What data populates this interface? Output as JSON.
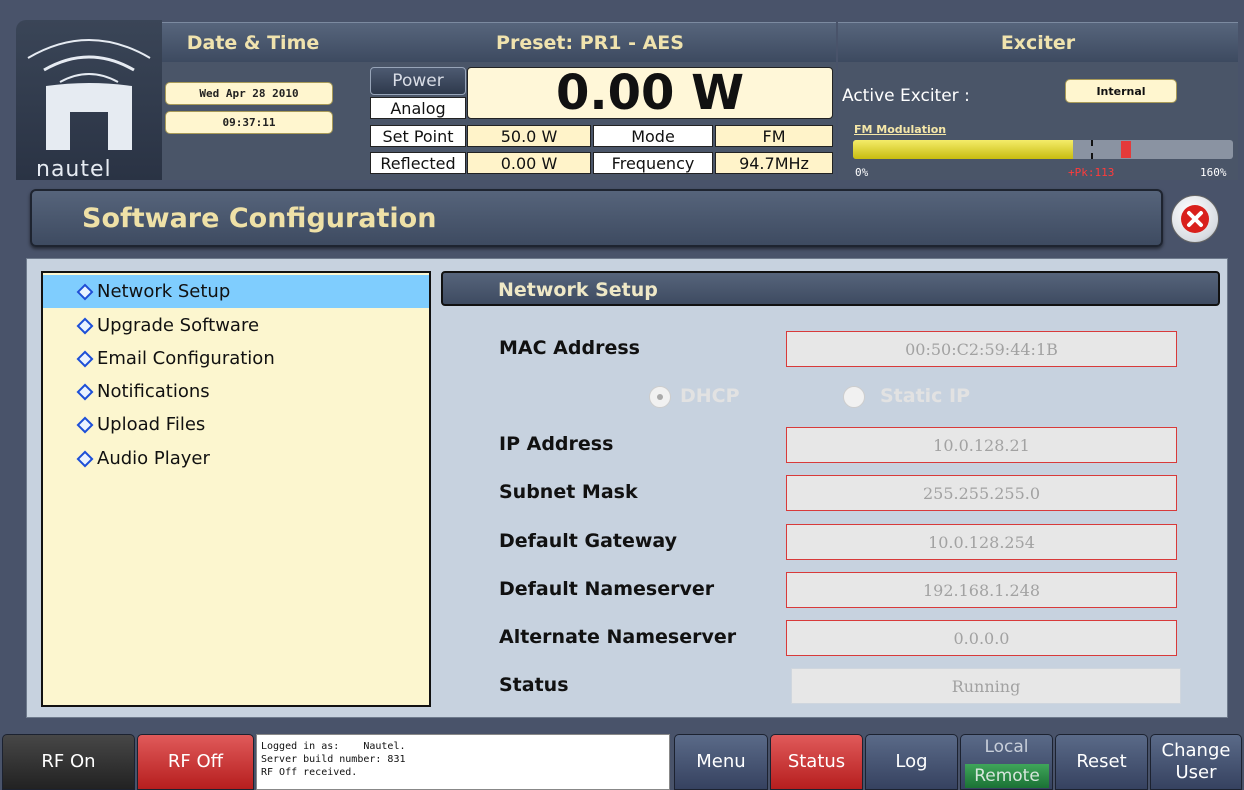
{
  "colors": {
    "header_gold": "#f0e3ae",
    "accent_blue": "#7fcdfe",
    "rf_off_red": "#b61e1e",
    "field_border_red": "#d83a3a",
    "fm_bar_yellow": "#e8dc30",
    "fm_peak_red": "#e43a3a",
    "remote_green": "#1b7235"
  },
  "logo": {
    "word": "nautel"
  },
  "header": {
    "date_time": {
      "tab": "Date & Time",
      "date": "Wed Apr 28 2010",
      "time": "09:37:11"
    },
    "preset": {
      "tab": "Preset: PR1 - AES",
      "power_button": "Power",
      "analog_label": "Analog",
      "power_value": "0.00 W",
      "set_point_label": "Set Point",
      "set_point_value": "50.0 W",
      "mode_label": "Mode",
      "mode_value": "FM",
      "reflected_label": "Reflected",
      "reflected_value": "0.00 W",
      "frequency_label": "Frequency",
      "frequency_value": "94.7MHz"
    },
    "exciter": {
      "tab": "Exciter",
      "active_label": "Active Exciter :",
      "active_value": "Internal",
      "modulation_label": "FM Modulation",
      "modulation_percent": 113,
      "modulation_fill_fraction": 0.58,
      "scale_min": "0%",
      "scale_max": "160%",
      "peak_label": "+Pk:113"
    }
  },
  "page": {
    "title": "Software Configuration",
    "close_icon": "close-x-icon"
  },
  "nav": {
    "items": [
      {
        "label": "Network Setup",
        "active": true
      },
      {
        "label": "Upgrade Software",
        "active": false
      },
      {
        "label": "Email Configuration",
        "active": false
      },
      {
        "label": "Notifications",
        "active": false
      },
      {
        "label": "Upload Files",
        "active": false
      },
      {
        "label": "Audio Player",
        "active": false
      }
    ]
  },
  "network": {
    "heading": "Network Setup",
    "mac_label": "MAC Address",
    "mac_value": "00:50:C2:59:44:1B",
    "dhcp_label": "DHCP",
    "dhcp_selected": true,
    "static_label": "Static IP",
    "ip_label": "IP Address",
    "ip_value": "10.0.128.21",
    "subnet_label": "Subnet Mask",
    "subnet_value": "255.255.255.0",
    "gateway_label": "Default Gateway",
    "gateway_value": "10.0.128.254",
    "nameserver_label": "Default Nameserver",
    "nameserver_value": "192.168.1.248",
    "alt_nameserver_label": "Alternate Nameserver",
    "alt_nameserver_value": "0.0.0.0",
    "status_label": "Status",
    "status_value": "Running"
  },
  "footer": {
    "rf_on": "RF On",
    "rf_off": "RF Off",
    "msg_line1": "Logged in as:    Nautel.",
    "msg_line2": "Server build number: 831",
    "msg_line3": "RF Off received.",
    "menu": "Menu",
    "status": "Status",
    "log": "Log",
    "local": "Local",
    "remote": "Remote",
    "reset": "Reset",
    "change_user_1": "Change",
    "change_user_2": "User"
  }
}
